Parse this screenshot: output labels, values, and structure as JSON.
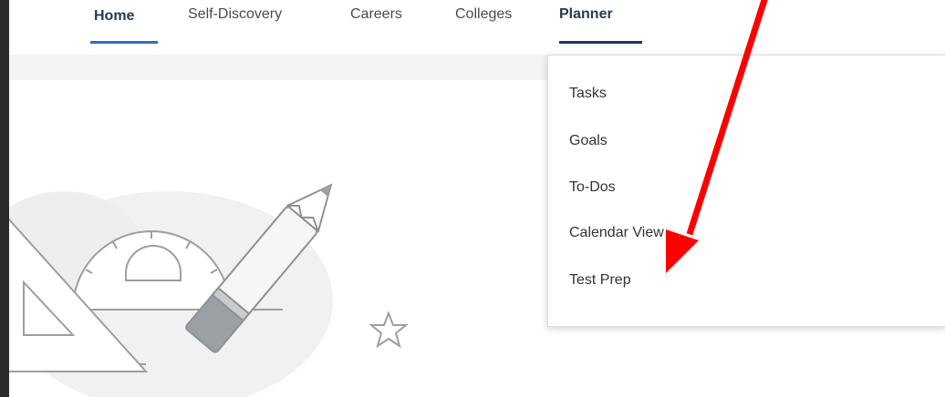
{
  "nav": {
    "tabs": [
      {
        "label": "Home",
        "active_underline": true
      },
      {
        "label": "Self-Discovery"
      },
      {
        "label": "Careers"
      },
      {
        "label": "Colleges"
      },
      {
        "label": "Planner",
        "open": true
      }
    ],
    "home_underline_color": "#2f6fc9",
    "planner_underline_color": "#1b3a5c"
  },
  "planner_menu": {
    "items": [
      {
        "label": "Tasks"
      },
      {
        "label": "Goals"
      },
      {
        "label": "To-Dos"
      },
      {
        "label": "Calendar View"
      },
      {
        "label": "Test Prep"
      }
    ]
  },
  "annotation": {
    "arrow_color": "#ff0000",
    "points_to": "Test Prep"
  },
  "icons": {
    "illustration": "drafting-tools-illustration",
    "star": "star-outline-icon"
  }
}
